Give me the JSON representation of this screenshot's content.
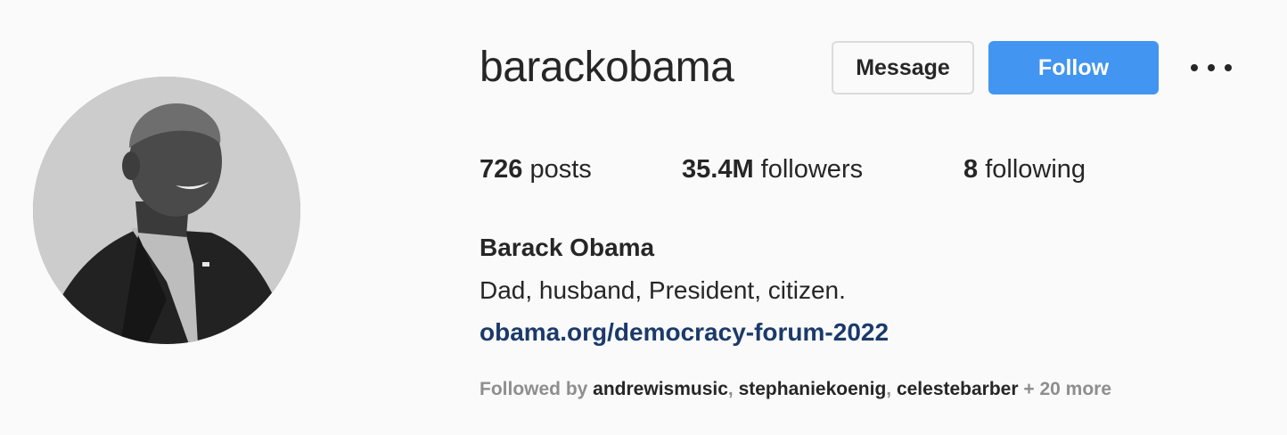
{
  "profile": {
    "username": "barackobama",
    "full_name": "Barack Obama",
    "bio": "Dad, husband, President, citizen.",
    "link": "obama.org/democracy-forum-2022",
    "avatar_icon": "profile-photo-grayscale"
  },
  "actions": {
    "message_label": "Message",
    "follow_label": "Follow",
    "more_icon": "more-horizontal-icon"
  },
  "stats": {
    "posts_count": "726",
    "posts_label": " posts",
    "followers_count": "35.4M",
    "followers_label": " followers",
    "following_count": "8",
    "following_label": " following"
  },
  "followed_by": {
    "prefix": "Followed by ",
    "accounts": [
      "andrewismusic",
      "stephaniekoenig",
      "celestebarber"
    ],
    "separator": ", ",
    "more": " + 20 more"
  },
  "colors": {
    "background": "#fafafa",
    "follow_button": "#4295f0",
    "link": "#1b3a6b",
    "muted_text": "#8e8e8e",
    "primary_text": "#262626"
  }
}
